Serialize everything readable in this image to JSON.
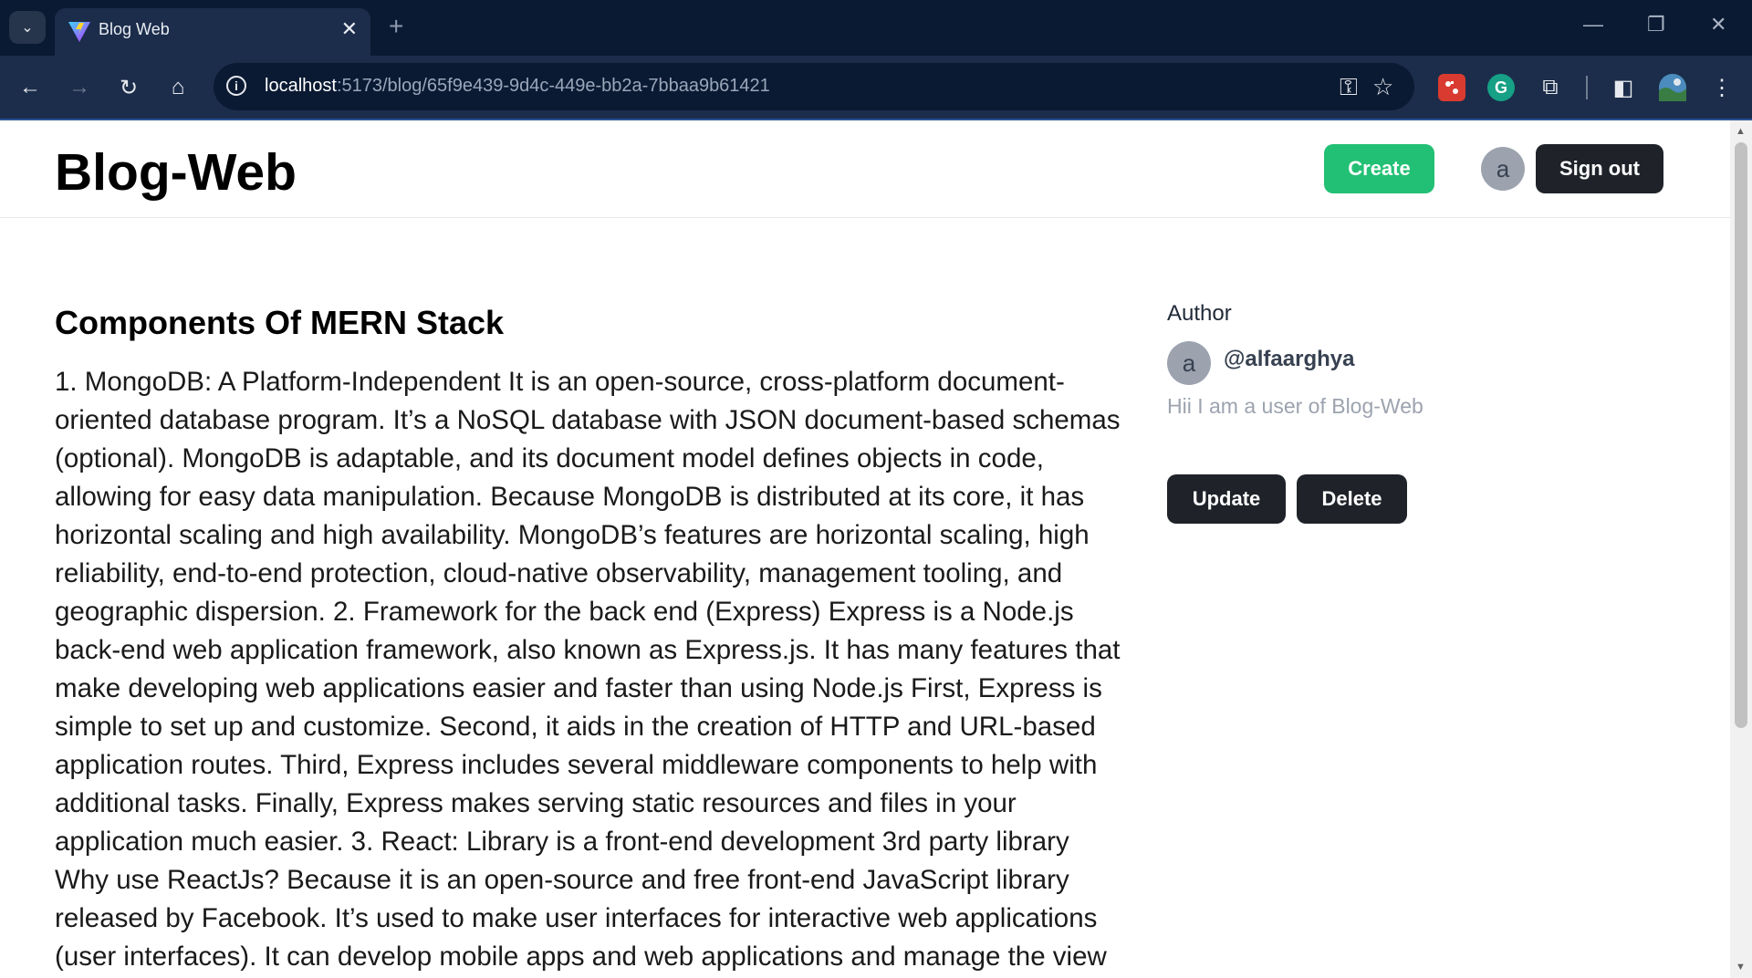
{
  "browser": {
    "tab_title": "Blog Web",
    "tab_close": "✕",
    "new_tab": "+",
    "url_host": "localhost",
    "url_path": ":5173/blog/65f9e439-9d4c-449e-bb2a-7bbaa9b61421"
  },
  "icons": {
    "tab_search": "⌄",
    "back": "←",
    "forward": "→",
    "reload": "↻",
    "home": "⌂",
    "info": "i",
    "password": "⚿",
    "bookmark": "☆",
    "minimize": "—",
    "restore": "❐",
    "close": "✕",
    "menu": "⋮",
    "ext_grammarly": "G",
    "ext_puzzle": "⧉",
    "side_panel": "◧"
  },
  "header": {
    "logo": "Blog-Web",
    "create_label": "Create",
    "avatar_initial": "a",
    "signout_label": "Sign out"
  },
  "article": {
    "title": "Components Of MERN Stack",
    "body": "1. MongoDB: A Platform-Independent It is an open-source, cross-platform document-oriented database program. It’s a NoSQL database with JSON document-based schemas (optional). MongoDB is adaptable, and its document model defines objects in code, allowing for easy data manipulation. Because MongoDB is distributed at its core, it has horizontal scaling and high availability. MongoDB’s features are horizontal scaling, high reliability, end-to-end protection, cloud-native observability, management tooling, and geographic dispersion. 2. Framework for the back end (Express) Express is a Node.js back-end web application framework, also known as Express.js. It has many features that make developing web applications easier and faster than using Node.js First, Express is simple to set up and customize. Second, it aids in the creation of HTTP and URL-based application routes. Third, Express includes several middleware components to help with additional tasks. Finally, Express makes serving static resources and files in your application much easier. 3. React: Library is a front-end development 3rd party library Why use ReactJs? Because it is an open-source and free front-end JavaScript library released by Facebook. It’s used to make user interfaces for interactive web applications (user interfaces). It can develop mobile apps and web applications and manage the view"
  },
  "sidebar": {
    "heading": "Author",
    "avatar_initial": "a",
    "username": "@alfaarghya",
    "bio": "Hii I am a user of Blog-Web",
    "update_label": "Update",
    "delete_label": "Delete"
  },
  "colors": {
    "create": "#22c074",
    "dark_button": "#1f2329",
    "browser_frame": "#0b1a33"
  }
}
